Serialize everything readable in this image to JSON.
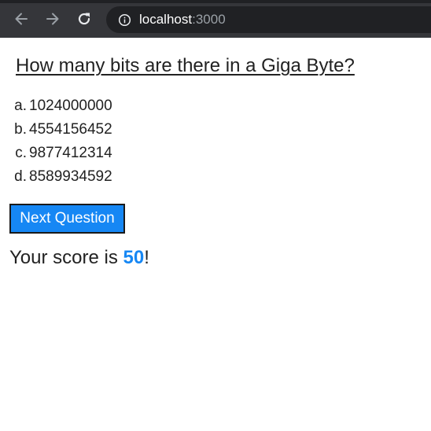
{
  "browser": {
    "url_host": "localhost",
    "url_port": ":3000",
    "icons": {
      "back": "arrow-left-icon",
      "forward": "arrow-right-icon",
      "reload": "reload-icon",
      "info": "info-icon"
    }
  },
  "quiz": {
    "question": "How many bits are there in a Giga Byte?",
    "options": [
      {
        "marker": "a.",
        "text": "1024000000"
      },
      {
        "marker": "b.",
        "text": "4554156452"
      },
      {
        "marker": "c.",
        "text": "9877412314"
      },
      {
        "marker": "d.",
        "text": "8589934592"
      }
    ],
    "next_label": "Next Question",
    "score_prefix": "Your score is ",
    "score_value": "50",
    "score_suffix": "!"
  },
  "colors": {
    "accent": "#1687f4",
    "toolbar": "#35363a",
    "omnibox": "#202124",
    "text": "#222222"
  }
}
